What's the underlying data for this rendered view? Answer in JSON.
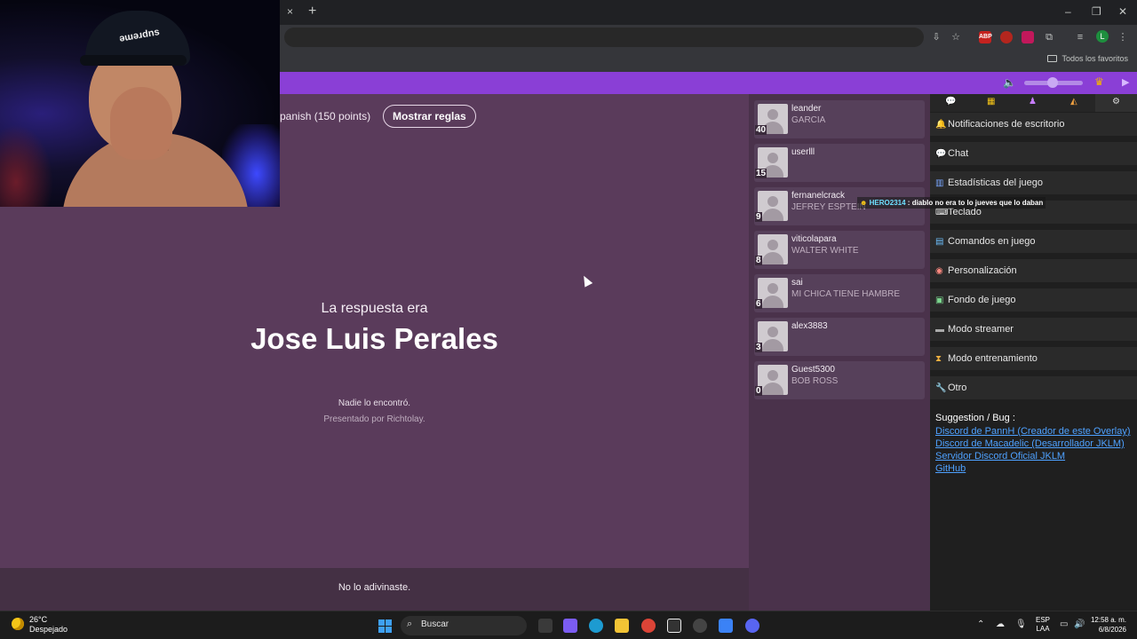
{
  "browser": {
    "bookmarks_folder": "Todos los favoritos",
    "profile_initial": "L",
    "tab_close": "×",
    "new_tab": "+",
    "window_controls": [
      "–",
      "❐",
      "✕"
    ]
  },
  "game": {
    "room_info": "panish (150 points)",
    "rules_button": "Mostrar reglas",
    "answer_label": "La respuesta era",
    "answer_value": "Jose Luis Perales",
    "nobody_found": "Nadie lo encontró.",
    "presented_by": "Presentado por Richtolay.",
    "footer_message": "No lo adivinaste."
  },
  "players": [
    {
      "name": "leander",
      "guess": "GARCIA",
      "score": "40"
    },
    {
      "name": "userlll",
      "guess": "",
      "score": "15"
    },
    {
      "name": "fernanelcrack",
      "guess": "JEFREY ESPTEIN",
      "score": "9"
    },
    {
      "name": "viticolapara",
      "guess": "WALTER WHITE",
      "score": "8"
    },
    {
      "name": "sai",
      "guess": "MI CHICA TIENE HAMBRE",
      "score": "6"
    },
    {
      "name": "alex3883",
      "guess": "",
      "score": "3"
    },
    {
      "name": "Guest5300",
      "guess": "BOB ROSS",
      "score": "0"
    }
  ],
  "chat_toast": {
    "user": "HERO2314",
    "message": " : diablo no era to lo jueves que lo daban"
  },
  "side_panel": {
    "tab_icons": [
      "chat-bubble-icon",
      "gift-icon",
      "joystick-icon",
      "palette-icon",
      "gear-icon"
    ],
    "menu": [
      {
        "icon": "bell-icon",
        "label": "Notificaciones de escritorio"
      },
      {
        "icon": "chat-bubble-icon",
        "label": "Chat"
      },
      {
        "icon": "stats-icon",
        "label": "Estadísticas del juego"
      },
      {
        "icon": "keyboard-icon",
        "label": "Teclado"
      },
      {
        "icon": "terminal-icon",
        "label": "Comandos en juego"
      },
      {
        "icon": "palette-icon",
        "label": "Personalización"
      },
      {
        "icon": "image-icon",
        "label": "Fondo de juego"
      },
      {
        "icon": "streamer-icon",
        "label": "Modo streamer"
      },
      {
        "icon": "hourglass-icon",
        "label": "Modo entrenamiento"
      },
      {
        "icon": "wrench-icon",
        "label": "Otro"
      }
    ],
    "suggestion_title": "Suggestion / Bug :",
    "links": [
      "Discord de PannH (Creador de este Overlay)",
      "Discord de Macadelic (Desarrollador JKLM)",
      "Servidor Discord Oficial JKLM",
      "GitHub"
    ]
  },
  "webcam": {
    "cap_text": "ǝɯǝɹdns"
  },
  "taskbar": {
    "temperature": "26°C",
    "weather": "Despejado",
    "search_placeholder": "Buscar",
    "lang_line1": "ESP",
    "lang_line2": "LAA",
    "time": "12:58 a. m.",
    "date": "6/8/2026"
  },
  "colors": {
    "game_bg": "#5a3b5b",
    "header_purple": "#8a3fd6",
    "link_blue": "#4ea1ff"
  }
}
